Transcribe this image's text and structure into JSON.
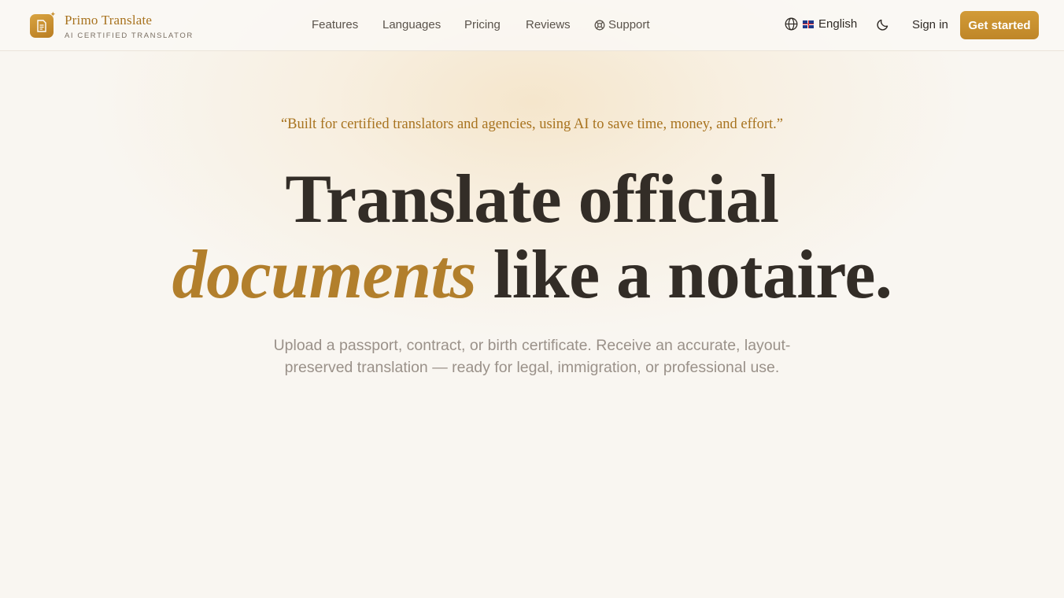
{
  "brand": {
    "name": "Primo Translate",
    "tagline": "AI CERTIFIED TRANSLATOR",
    "logo_icon": "document-icon"
  },
  "nav": {
    "items": [
      {
        "label": "Features"
      },
      {
        "label": "Languages"
      },
      {
        "label": "Pricing"
      },
      {
        "label": "Reviews"
      },
      {
        "label": "Support",
        "icon": "lifebuoy-icon"
      }
    ]
  },
  "header_actions": {
    "language_icon": "globe-icon",
    "language_flag": "uk-flag",
    "language_label": "English",
    "theme_icon": "moon-icon",
    "signin_label": "Sign in",
    "cta_label": "Get started"
  },
  "hero": {
    "quote": "“Built for certified translators and agencies, using AI to save time, money, and effort.”",
    "headline_line1": "Translate official",
    "headline_accent": "documents",
    "headline_line2_rest": " like a notaire.",
    "subtitle": "Upload a passport, contract, or birth certificate. Receive an accurate, layout-preserved translation — ready for legal, immigration, or professional use."
  },
  "colors": {
    "accent": "#b27f2c",
    "cta": "#c98f2e",
    "background": "#f9f6f1",
    "heading": "#332d27"
  }
}
